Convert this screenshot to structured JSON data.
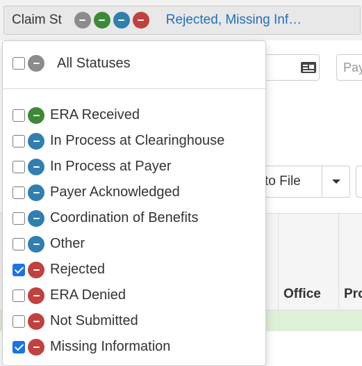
{
  "toggle": {
    "label": "Claim St",
    "selected_text": "Rejected, Missing Inf…",
    "dots": [
      "gray",
      "green",
      "blue",
      "red"
    ]
  },
  "menu": {
    "all": {
      "label": "All Statuses",
      "checked": false,
      "color": "gray"
    },
    "items": [
      {
        "label": "ERA Received",
        "checked": false,
        "color": "green"
      },
      {
        "label": "In Process at Clearinghouse",
        "checked": false,
        "color": "blue"
      },
      {
        "label": "In Process at Payer",
        "checked": false,
        "color": "blue"
      },
      {
        "label": "Payer Acknowledged",
        "checked": false,
        "color": "blue"
      },
      {
        "label": "Coordination of Benefits",
        "checked": false,
        "color": "blue"
      },
      {
        "label": "Other",
        "checked": false,
        "color": "blue"
      },
      {
        "label": "Rejected",
        "checked": true,
        "color": "red"
      },
      {
        "label": "ERA Denied",
        "checked": false,
        "color": "red"
      },
      {
        "label": "Not Submitted",
        "checked": false,
        "color": "red"
      },
      {
        "label": "Missing Information",
        "checked": true,
        "color": "red"
      }
    ]
  },
  "background": {
    "payer_placeholder": "Pay",
    "split_button_label": "to File",
    "table_headers": [
      "Office",
      "Pro"
    ]
  },
  "colors": {
    "gray": "#8c8c8c",
    "green": "#3c8a35",
    "blue": "#2f7fb0",
    "red": "#c0413f",
    "link": "#1f6fbd",
    "checkbox_checked": "#1a73e8"
  }
}
